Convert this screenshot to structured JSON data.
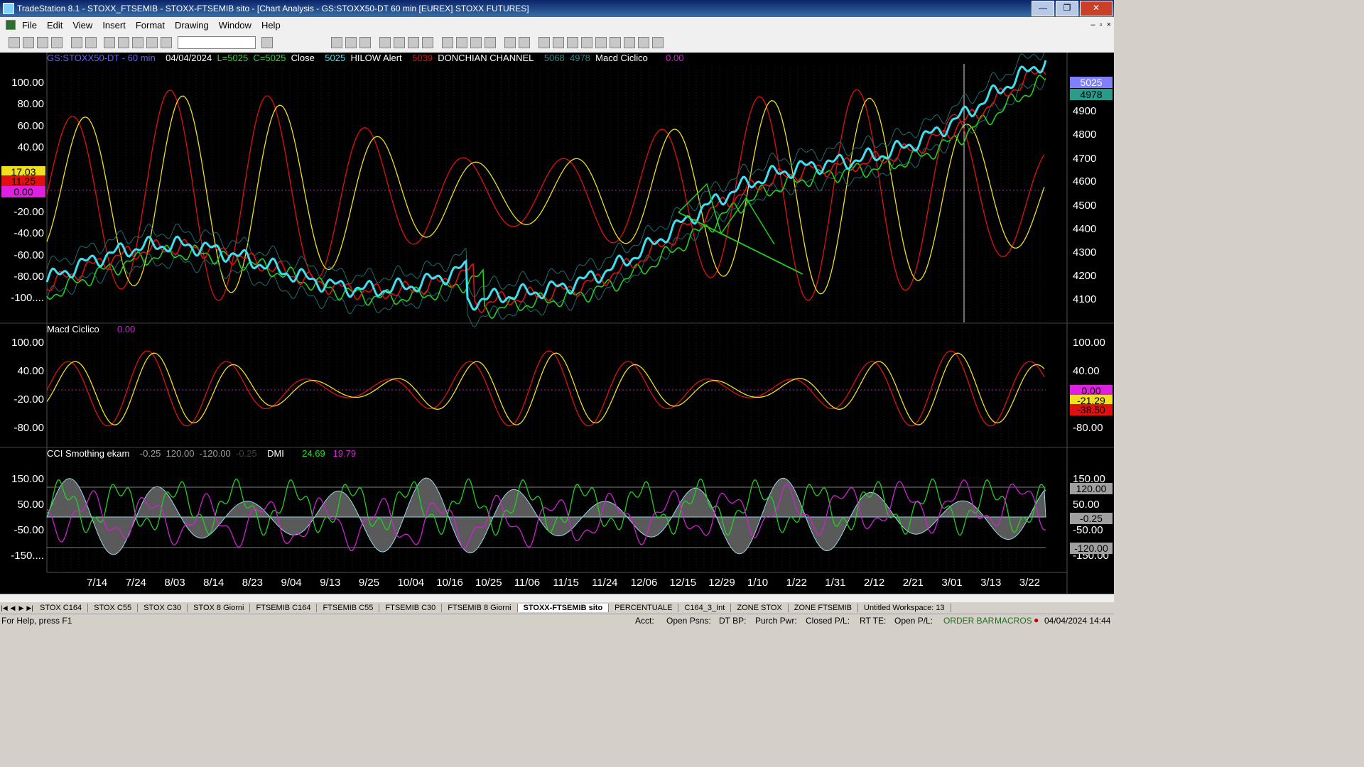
{
  "window": {
    "title": "TradeStation 8.1 - STOXX_FTSEMIB - STOXX-FTSEMIB sito - [Chart Analysis - GS:STOXX50-DT  60 min  [EUREX] STOXX FUTURES]",
    "minimize": "—",
    "restore": "❐",
    "close": "✕"
  },
  "menu": {
    "items": [
      "File",
      "Edit",
      "View",
      "Insert",
      "Format",
      "Drawing",
      "Window",
      "Help"
    ],
    "mdi_min": "–",
    "mdi_restore": "▫",
    "mdi_close": "×"
  },
  "chart_header": {
    "symbol": "GS:STOXX50-DT - 60 min",
    "date": "04/04/2024",
    "low": "L=5025",
    "close_val": "C=5025",
    "close_label": "Close",
    "hilow_val": "5025",
    "hilow_label": "HILOW Alert",
    "donchian_val": "5039",
    "donchian_label": "DONCHIAN CHANNEL",
    "dc_upper": "5068",
    "dc_lower": "4978",
    "macd_label": "Macd Ciclico",
    "macd_val": "0.00"
  },
  "panel1": {
    "left_ticks": [
      "100.00",
      "80.00",
      "60.00",
      "40.00",
      "-20.00",
      "-40.00",
      "-60.00",
      "-80.00",
      "-100...."
    ],
    "left_tags": [
      "17.03",
      "11.25",
      "0.00"
    ],
    "right_ticks": [
      "4900",
      "4800",
      "4700",
      "4600",
      "4500",
      "4400",
      "4300",
      "4200",
      "4100"
    ],
    "right_tags": [
      "5025",
      "4978"
    ]
  },
  "panel2": {
    "title": "Macd Ciclico",
    "value": "0.00",
    "left_ticks": [
      "100.00",
      "40.00",
      "-20.00",
      "-80.00"
    ],
    "right_ticks": [
      "100.00",
      "40.00",
      "-80.00"
    ],
    "right_tags": [
      "0.00",
      "-21.29",
      "-38.50"
    ]
  },
  "panel3": {
    "title": "CCI Smothing ekam",
    "v1": "-0.25",
    "v2": "120.00",
    "v3": "-120.00",
    "v4": "-0.25",
    "dmi_label": "DMI",
    "dmi_plus": "24.69",
    "dmi_minus": "19.79",
    "left_ticks": [
      "150.00",
      "50.00",
      "-50.00",
      "-150...."
    ],
    "right_ticks": [
      "150.00",
      "50.00",
      "-50.00",
      "-150.00"
    ],
    "right_tags": [
      "120.00",
      "-0.25",
      "-120.00"
    ]
  },
  "x_axis": [
    "7/14",
    "7/24",
    "8/03",
    "8/14",
    "8/23",
    "9/04",
    "9/13",
    "9/25",
    "10/04",
    "10/16",
    "10/25",
    "11/06",
    "11/15",
    "11/24",
    "12/06",
    "12/15",
    "12/29",
    "1/10",
    "1/22",
    "1/31",
    "2/12",
    "2/21",
    "3/01",
    "3/13",
    "3/22"
  ],
  "tabs": [
    "STOX C164",
    "STOX C55",
    "STOX  C30",
    "STOX  8 Giorni",
    "FTSEMIB C164",
    "FTSEMIB C55",
    "FTSEMIB C30",
    "FTSEMIB  8 Giorni",
    "STOXX-FTSEMIB sito",
    "PERCENTUALE",
    "C164_3_Int",
    "ZONE STOX",
    "ZONE FTSEMIB",
    "Untitled Workspace:  13"
  ],
  "active_tab": "STOXX-FTSEMIB sito",
  "status": {
    "help": "For Help, press F1",
    "acct": "Acct:",
    "open_psns": "Open Psns:",
    "dt_bp": "DT BP:",
    "purch_pwr": "Purch Pwr:",
    "closed_pl": "Closed P/L:",
    "rt_te": "RT TE:",
    "open_pl": "Open P/L:",
    "order_bar": "ORDER BAR",
    "macros": "MACROS",
    "datetime": "04/04/2024 14:44"
  },
  "colors": {
    "cyan": "#3ee0f0",
    "red": "#e01010",
    "yellow": "#f0e020",
    "green": "#20d020",
    "magenta": "#d020d0",
    "teal": "#2a8a8a"
  }
}
